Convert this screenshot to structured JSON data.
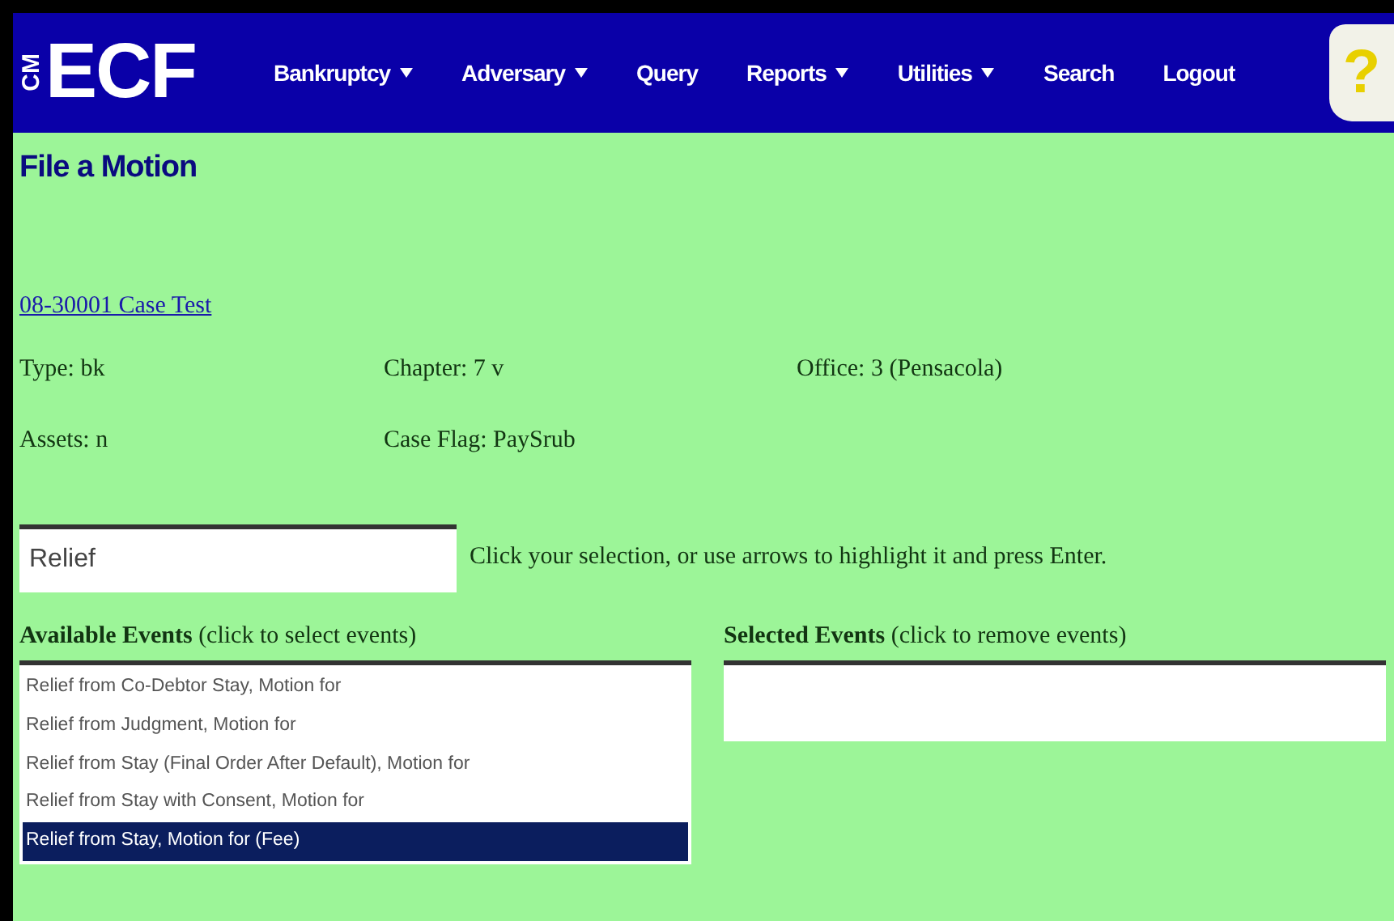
{
  "logo": {
    "prefix": "CM",
    "text": "ECF"
  },
  "menu": [
    {
      "label": "Bankruptcy",
      "has_menu": true
    },
    {
      "label": "Adversary",
      "has_menu": true
    },
    {
      "label": "Query",
      "has_menu": false
    },
    {
      "label": "Reports",
      "has_menu": true
    },
    {
      "label": "Utilities",
      "has_menu": true
    },
    {
      "label": "Search",
      "has_menu": false
    },
    {
      "label": "Logout",
      "has_menu": false
    }
  ],
  "help": {
    "label": "?"
  },
  "page_title": "File a Motion",
  "case_link": "08-30001 Case Test",
  "case_info": [
    [
      "Type: bk",
      "Chapter: 7 v",
      "Office: 3 (Pensacola)"
    ],
    [
      "Assets: n",
      "Case Flag: PaySrub"
    ]
  ],
  "search": {
    "value": "Relief",
    "hint": "Click your selection, or use arrows to highlight it and press Enter."
  },
  "available": {
    "title": "Available Events",
    "note": "(click to select events)",
    "items": [
      {
        "label": "Relief from Co-Debtor Stay, Motion for",
        "selected": false
      },
      {
        "label": "Relief from Judgment, Motion for",
        "selected": false
      },
      {
        "label": "Relief from Stay (Final Order After Default), Motion for",
        "selected": false
      },
      {
        "label": "Relief from Stay with Consent, Motion for",
        "selected": false
      },
      {
        "label": "Relief from Stay, Motion for (Fee)",
        "selected": true
      }
    ]
  },
  "selected_events": {
    "title": "Selected Events",
    "note": "(click to remove  events)"
  }
}
